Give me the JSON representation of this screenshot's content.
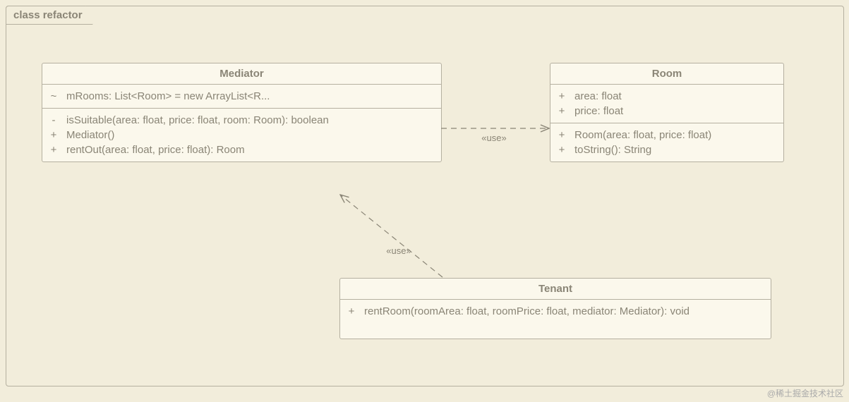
{
  "chart_data": {
    "type": "uml_class_diagram",
    "frame": "class refactor",
    "classes": [
      {
        "name": "Mediator",
        "attributes": [
          {
            "visibility": "~",
            "signature": "mRooms: List<Room> = new ArrayList<R..."
          }
        ],
        "operations": [
          {
            "visibility": "-",
            "signature": "isSuitable(area: float, price: float, room: Room): boolean"
          },
          {
            "visibility": "+",
            "signature": "Mediator()"
          },
          {
            "visibility": "+",
            "signature": "rentOut(area: float, price: float): Room"
          }
        ]
      },
      {
        "name": "Room",
        "attributes": [
          {
            "visibility": "+",
            "signature": "area: float"
          },
          {
            "visibility": "+",
            "signature": "price: float"
          }
        ],
        "operations": [
          {
            "visibility": "+",
            "signature": "Room(area: float, price: float)"
          },
          {
            "visibility": "+",
            "signature": "toString(): String"
          }
        ]
      },
      {
        "name": "Tenant",
        "attributes": [],
        "operations": [
          {
            "visibility": "+",
            "signature": "rentRoom(roomArea: float, roomPrice: float, mediator: Mediator): void"
          }
        ]
      }
    ],
    "relationships": [
      {
        "from": "Mediator",
        "to": "Room",
        "type": "dependency",
        "stereotype": "«use»"
      },
      {
        "from": "Tenant",
        "to": "Mediator",
        "type": "dependency",
        "stereotype": "«use»"
      }
    ]
  },
  "frame": {
    "title": "class refactor"
  },
  "mediator": {
    "title": "Mediator",
    "attr0_vis": "~",
    "attr0_sig": "mRooms: List<Room> = new ArrayList<R...",
    "op0_vis": "-",
    "op0_sig": "isSuitable(area: float, price: float, room: Room): boolean",
    "op1_vis": "+",
    "op1_sig": "Mediator()",
    "op2_vis": "+",
    "op2_sig": "rentOut(area: float, price: float): Room"
  },
  "room": {
    "title": "Room",
    "attr0_vis": "+",
    "attr0_sig": "area: float",
    "attr1_vis": "+",
    "attr1_sig": "price: float",
    "op0_vis": "+",
    "op0_sig": "Room(area: float, price: float)",
    "op1_vis": "+",
    "op1_sig": "toString(): String"
  },
  "tenant": {
    "title": "Tenant",
    "op0_vis": "+",
    "op0_sig": "rentRoom(roomArea: float, roomPrice: float, mediator: Mediator): void"
  },
  "stereo": {
    "use": "«use»"
  },
  "watermark": "@稀土掘金技术社区"
}
